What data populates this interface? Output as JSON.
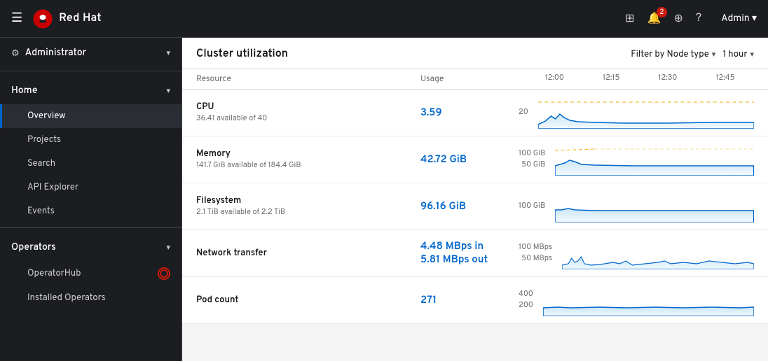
{
  "topnav": {
    "hamburger_label": "☰",
    "brand": "Red Hat",
    "icons": {
      "grid": "⊞",
      "bell_label": "🔔",
      "bell_count": "2",
      "plus_label": "+",
      "help_label": "?"
    },
    "user_label": "Admin ▾"
  },
  "sidebar": {
    "admin_label": "Administrator",
    "admin_chevron": "▾",
    "sections": [
      {
        "label": "Home",
        "chevron": "▾",
        "items": [
          {
            "label": "Overview",
            "active": true
          },
          {
            "label": "Projects"
          },
          {
            "label": "Search"
          },
          {
            "label": "API Explorer"
          },
          {
            "label": "Events"
          }
        ]
      },
      {
        "label": "Operators",
        "chevron": "▾",
        "items": [
          {
            "label": "OperatorHub",
            "badge": true
          },
          {
            "label": "Installed Operators"
          }
        ]
      }
    ]
  },
  "cluster": {
    "title": "Cluster utilization",
    "filter_node_label": "Filter by Node type",
    "filter_time_label": "1 hour",
    "columns": {
      "resource": "Resource",
      "usage": "Usage"
    },
    "time_ticks": [
      "12:00",
      "12:15",
      "12:30",
      "12:45"
    ],
    "metrics": [
      {
        "name": "CPU",
        "sub": "36.41 available of 40",
        "usage": "3.59",
        "scale_top": "20",
        "scale_bottom": "",
        "chart_type": "cpu"
      },
      {
        "name": "Memory",
        "sub": "141.7 GiB available of 184.4 GiB",
        "usage": "42.72 GiB",
        "scale_top": "100 GiB",
        "scale_bottom": "50 GiB",
        "chart_type": "memory"
      },
      {
        "name": "Filesystem",
        "sub": "2.1 TiB available of 2.2 TiB",
        "usage": "96.16 GiB",
        "scale_top": "100 GiB",
        "scale_bottom": "",
        "chart_type": "filesystem"
      },
      {
        "name": "Network transfer",
        "sub": "",
        "usage_line1": "4.48 MBps in",
        "usage_line2": "5.81 MBps out",
        "scale_top": "100 MBps",
        "scale_bottom": "50 MBps",
        "chart_type": "network"
      },
      {
        "name": "Pod count",
        "sub": "",
        "usage": "271",
        "scale_top": "400",
        "scale_bottom": "200",
        "chart_type": "pods"
      }
    ]
  }
}
